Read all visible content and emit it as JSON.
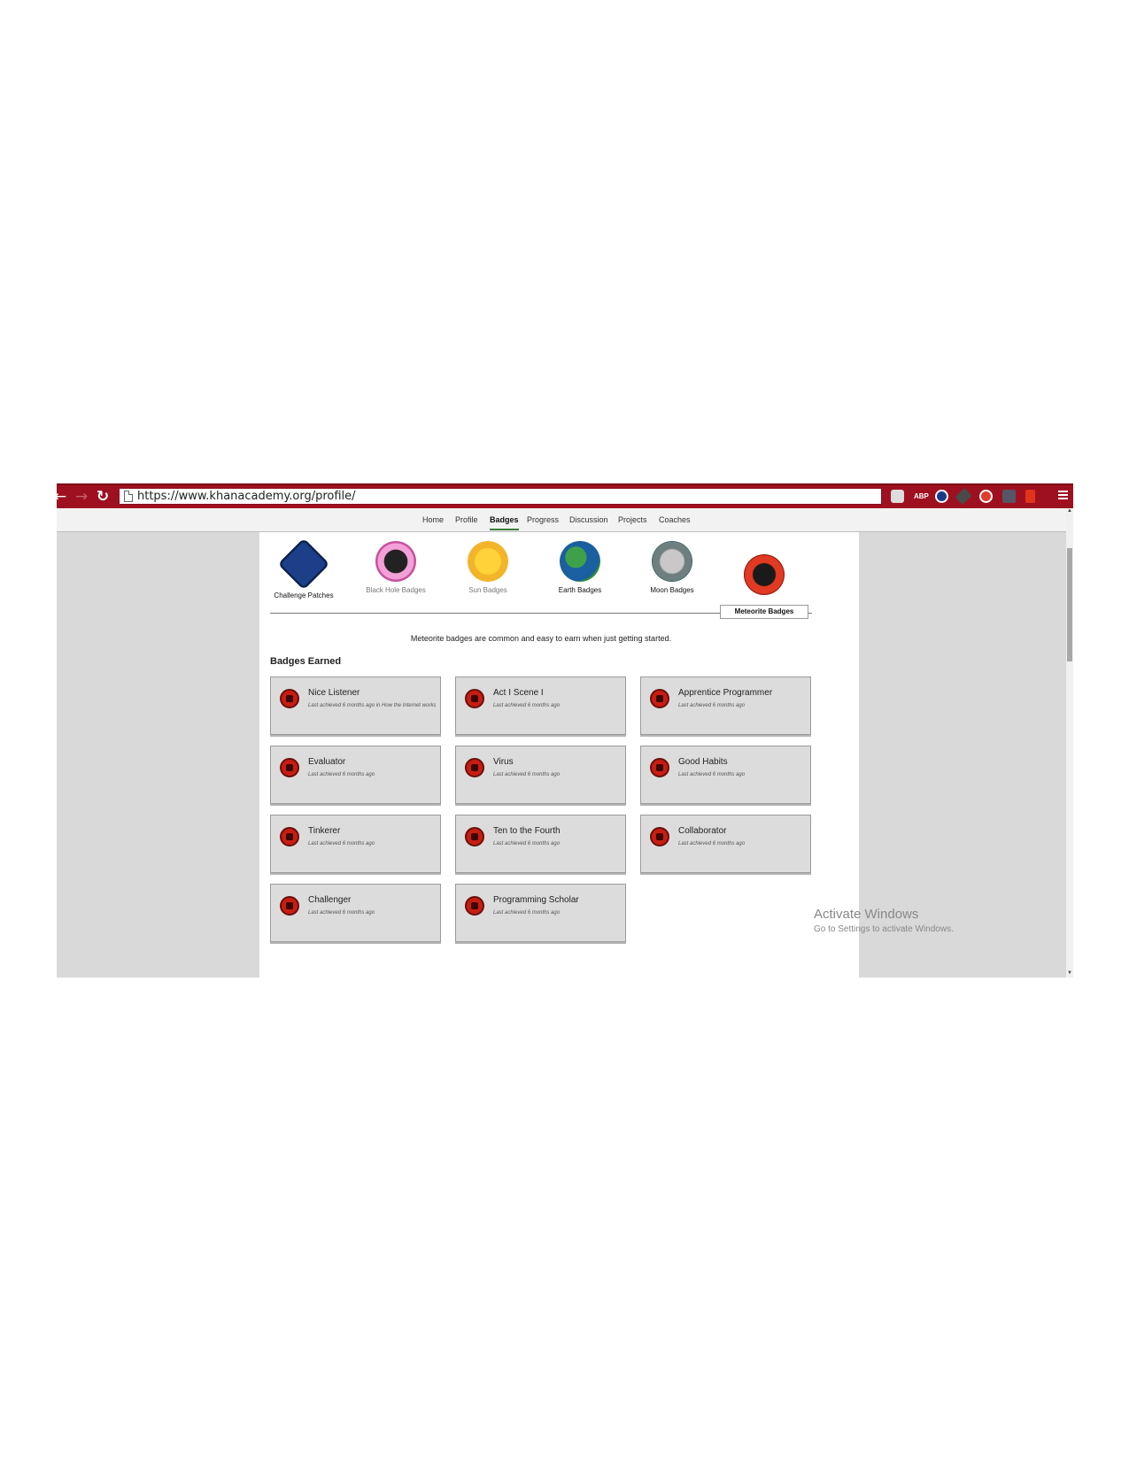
{
  "browser": {
    "url": "https://www.khanacademy.org/profile/",
    "back_glyph": "←",
    "forward_glyph": "→",
    "reload_glyph": "↻",
    "abp_label": "ABP",
    "theme_color": "#9e1020"
  },
  "subnav": {
    "items": [
      "Home",
      "Profile",
      "Badges",
      "Progress",
      "Discussion",
      "Projects",
      "Coaches"
    ],
    "active": "Badges"
  },
  "categories": [
    {
      "label": "Challenge Patches",
      "icon": "challenge-patch-icon",
      "color": "#1d3f8a"
    },
    {
      "label": "Black Hole Badges",
      "icon": "black-hole-icon",
      "color": "#d85fb0"
    },
    {
      "label": "Sun Badges",
      "icon": "sun-icon",
      "color": "#f2b52a"
    },
    {
      "label": "Earth Badges",
      "icon": "earth-icon",
      "color": "#2f8a3a"
    },
    {
      "label": "Moon Badges",
      "icon": "moon-icon",
      "color": "#0f4a4a"
    },
    {
      "label": "Meteorite Badges",
      "icon": "meteorite-icon",
      "color": "#d02010"
    }
  ],
  "description": "Meteorite badges are common and easy to earn when just getting started.",
  "earned_heading": "Badges Earned",
  "badges": [
    {
      "name": "Nice Listener",
      "sub": "Last achieved 6 months ago in How the Internet works",
      "icon": "speaker-icon"
    },
    {
      "name": "Act I Scene I",
      "sub": "Last achieved 6 months ago",
      "icon": "theater-icon"
    },
    {
      "name": "Apprentice Programmer",
      "sub": "Last achieved 6 months ago",
      "icon": "code-icon"
    },
    {
      "name": "Evaluator",
      "sub": "Last achieved 6 months ago",
      "icon": "evaluator-icon"
    },
    {
      "name": "Virus",
      "sub": "Last achieved 6 months ago",
      "icon": "virus-icon"
    },
    {
      "name": "Good Habits",
      "sub": "Last achieved 6 months ago",
      "icon": "calendar-icon"
    },
    {
      "name": "Tinkerer",
      "sub": "Last achieved 6 months ago",
      "icon": "tools-icon"
    },
    {
      "name": "Ten to the Fourth",
      "sub": "Last achieved 6 months ago",
      "icon": "ten-fourth-icon"
    },
    {
      "name": "Collaborator",
      "sub": "Last achieved 6 months ago",
      "icon": "collaborator-icon"
    },
    {
      "name": "Challenger",
      "sub": "Last achieved 6 months ago",
      "icon": "tools-icon"
    },
    {
      "name": "Programming Scholar",
      "sub": "Last achieved 6 months ago",
      "icon": "monitor-icon"
    }
  ],
  "watermark": {
    "line1": "Activate Windows",
    "line2": "Go to Settings to activate Windows."
  }
}
